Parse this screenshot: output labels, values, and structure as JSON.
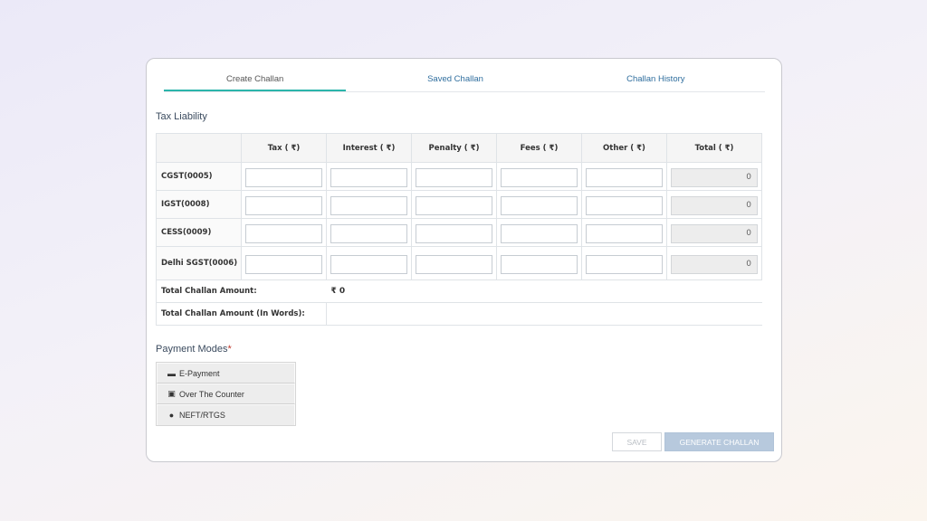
{
  "tabs": [
    {
      "label": "Create Challan",
      "active": true
    },
    {
      "label": "Saved Challan",
      "active": false
    },
    {
      "label": "Challan History",
      "active": false
    }
  ],
  "tax_liability": {
    "title": "Tax Liability",
    "columns": [
      "",
      "Tax ( ₹)",
      "Interest ( ₹)",
      "Penalty ( ₹)",
      "Fees ( ₹)",
      "Other ( ₹)",
      "Total ( ₹)"
    ],
    "rows": [
      {
        "label": "CGST(0005)",
        "total": "0"
      },
      {
        "label": "IGST(0008)",
        "total": "0"
      },
      {
        "label": "CESS(0009)",
        "total": "0"
      },
      {
        "label": "Delhi SGST(0006)",
        "total": "0"
      }
    ],
    "total_amount_label": "Total Challan Amount:",
    "total_amount_value": "₹ 0",
    "total_words_label": "Total Challan Amount (In Words):",
    "total_words_value": ""
  },
  "payment": {
    "title": "Payment Modes",
    "required_mark": "*",
    "modes": [
      {
        "label": "E-Payment",
        "icon": "credit-card-icon",
        "glyph": "▬"
      },
      {
        "label": "Over The Counter",
        "icon": "cash-icon",
        "glyph": "▣"
      },
      {
        "label": "NEFT/RTGS",
        "icon": "globe-icon",
        "glyph": "●"
      }
    ]
  },
  "buttons": {
    "save": "SAVE",
    "generate": "GENERATE CHALLAN"
  },
  "colors": {
    "accent_tab": "#2bb5ab",
    "link": "#2f6e9e",
    "primary_disabled": "#b7c9dd"
  }
}
